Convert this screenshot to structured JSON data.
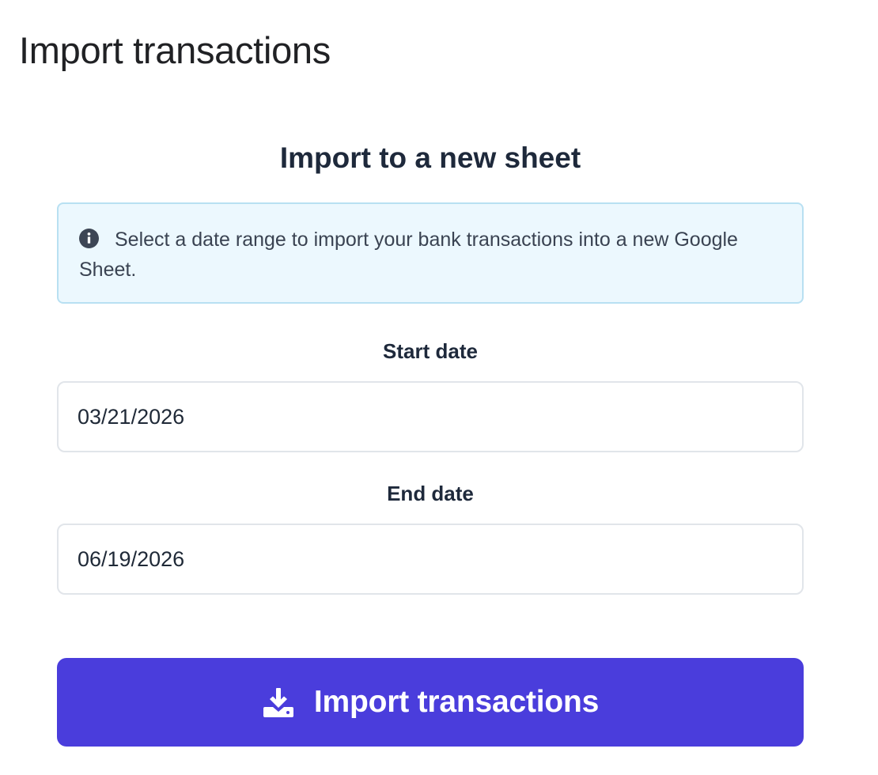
{
  "window": {
    "title": "Import transactions"
  },
  "section": {
    "heading": "Import to a new sheet"
  },
  "info": {
    "icon": "info-icon",
    "message": "Select a date range to import your bank transactions into a new Google Sheet."
  },
  "start_date": {
    "label": "Start date",
    "value": "03/21/2026"
  },
  "end_date": {
    "label": "End date",
    "value": "06/19/2026"
  },
  "import_button": {
    "icon": "download-icon",
    "label": "Import transactions"
  },
  "colors": {
    "accent": "#4a3ddc",
    "info_background": "#ecf8fe",
    "info_border": "#b8e0f2",
    "text_dark": "#1e293b"
  }
}
